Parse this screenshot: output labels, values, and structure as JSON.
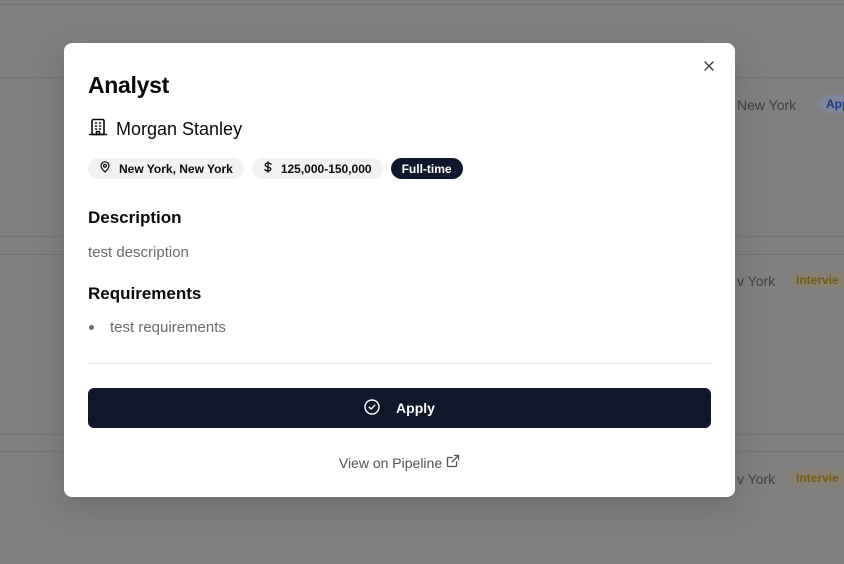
{
  "background": {
    "rows": [
      {
        "location": "New York",
        "badge": "App"
      },
      {
        "location": "v York",
        "badge": "Intervie"
      },
      {
        "location": "v York",
        "badge": "Intervie"
      }
    ]
  },
  "modal": {
    "title": "Analyst",
    "company": "Morgan Stanley",
    "chips": {
      "location": "New York, New York",
      "salary": "125,000-150,000",
      "type": "Full-time"
    },
    "description_heading": "Description",
    "description_text": "test description",
    "requirements_heading": "Requirements",
    "requirements": [
      "test requirements"
    ],
    "apply_label": "Apply",
    "pipeline_link": "View on Pipeline"
  },
  "icons": {
    "close": "close-icon",
    "company": "building-icon",
    "location": "map-pin-icon",
    "salary": "dollar-icon",
    "apply": "check-circle-icon",
    "external": "external-link-icon"
  },
  "colors": {
    "primary": "#0f172a",
    "overlay": "#7f7f80",
    "chip_bg": "#f1f1f3",
    "muted_text": "#6b6b70"
  }
}
